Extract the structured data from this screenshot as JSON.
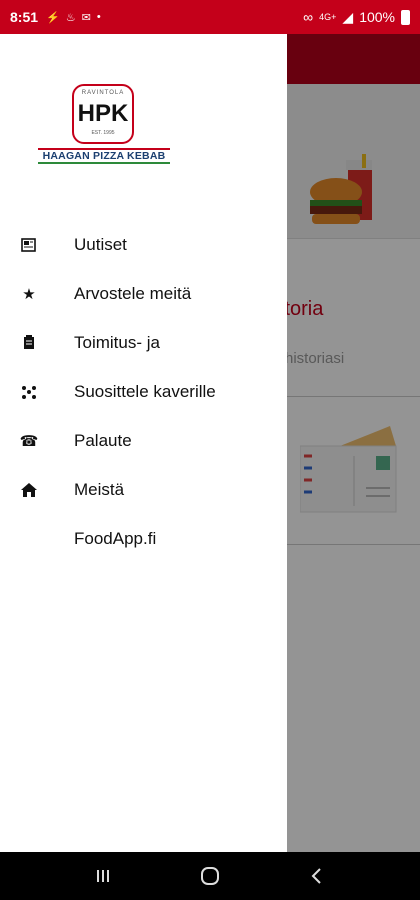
{
  "status_bar": {
    "time": "8:51",
    "battery_percent": "100%",
    "network": "4G+"
  },
  "drawer": {
    "logo": {
      "small_text": "RAVINTOLA",
      "mark": "HPK",
      "est_text": "EST. 1995",
      "restaurant_name": "HAAGAN PIZZA KEBAB"
    },
    "items": [
      {
        "label": "Uutiset",
        "icon": "newspaper-icon"
      },
      {
        "label": "Arvostele meitä",
        "icon": "star-icon"
      },
      {
        "label": "Toimitus- ja",
        "icon": "clipboard-icon"
      },
      {
        "label": "Suosittele kaverille",
        "icon": "share-icon"
      },
      {
        "label": "Palaute",
        "icon": "phone-icon"
      },
      {
        "label": "Meistä",
        "icon": "home-icon"
      },
      {
        "label": "FoodApp.fi",
        "icon": ""
      }
    ]
  },
  "background": {
    "section_title": "istoria",
    "section_subtitle": "historiasi"
  },
  "colors": {
    "brand_red": "#c4001a",
    "logo_blue": "#1b3f70",
    "logo_green": "#2d8a3a"
  }
}
